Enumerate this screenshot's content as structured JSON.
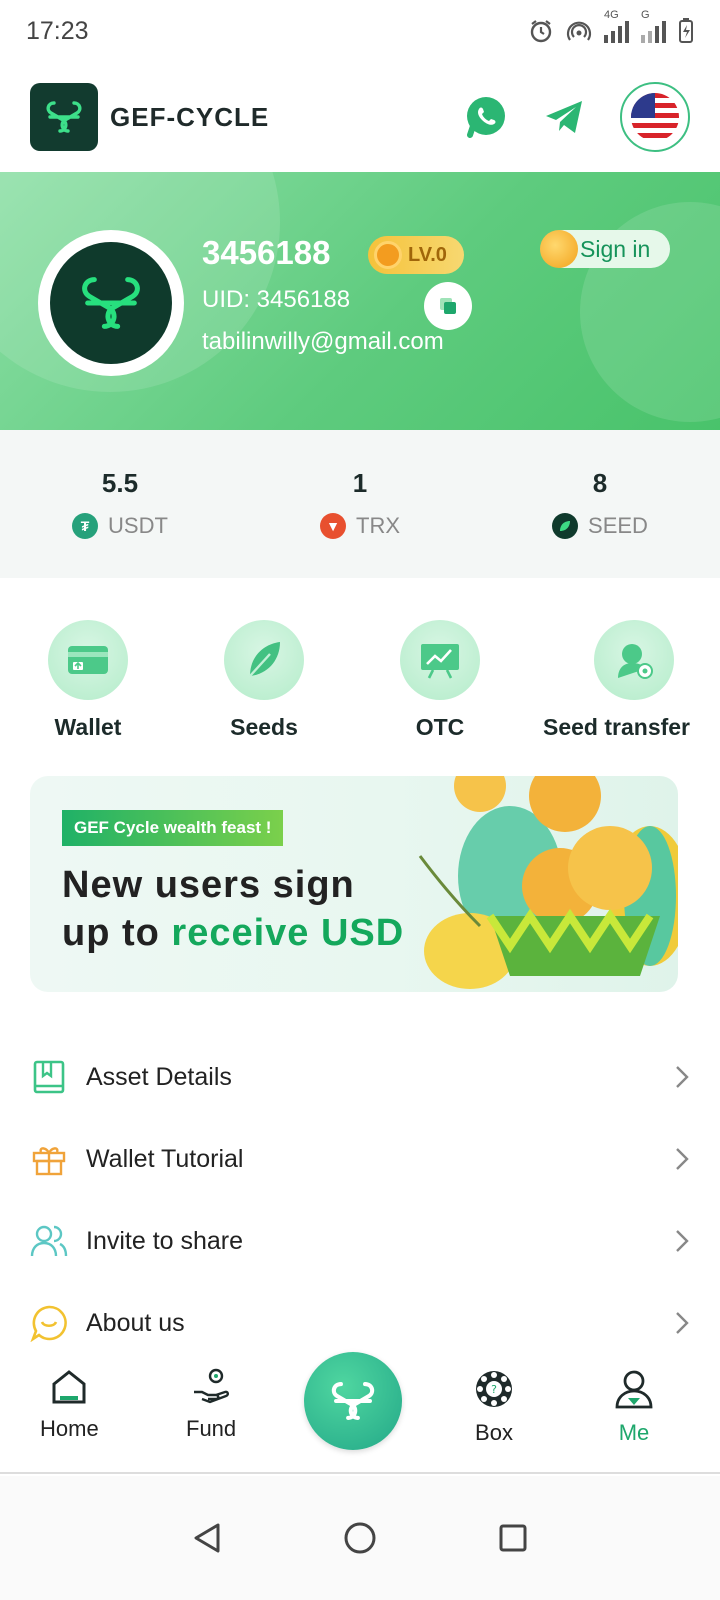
{
  "status_bar": {
    "time": "17:23",
    "network_label_1": "4G",
    "network_label_2": "G"
  },
  "header": {
    "logo_text": "GEF-CYCLE",
    "icons": [
      "whatsapp-icon",
      "telegram-icon",
      "us-flag-icon"
    ]
  },
  "profile": {
    "name": "3456188",
    "level": "LV.0",
    "uid": "UID: 3456188",
    "email": "tabilinwilly@gmail.com",
    "signin_label": "Sign in"
  },
  "balances": [
    {
      "value": "5.5",
      "currency": "USDT",
      "color": "#26a17b"
    },
    {
      "value": "1",
      "currency": "TRX",
      "color": "#e8502f"
    },
    {
      "value": "8",
      "currency": "SEED",
      "color": "#0f3a2c"
    }
  ],
  "quick_actions": [
    {
      "label": "Wallet",
      "icon": "wallet-icon"
    },
    {
      "label": "Seeds",
      "icon": "leaf-icon"
    },
    {
      "label": "OTC",
      "icon": "chart-board-icon"
    },
    {
      "label": "Seed transfer",
      "icon": "transfer-user-icon"
    }
  ],
  "promo": {
    "tag": "GEF Cycle wealth feast !",
    "line1": "New users sign",
    "line2_prefix": "up to ",
    "line2_highlight": "receive USD"
  },
  "menu": [
    {
      "label": "Asset Details",
      "icon": "book-icon"
    },
    {
      "label": "Wallet Tutorial",
      "icon": "gift-icon"
    },
    {
      "label": "Invite to share",
      "icon": "users-icon"
    },
    {
      "label": "About us",
      "icon": "smile-icon"
    }
  ],
  "bottom_nav": [
    {
      "label": "Home",
      "icon": "home-icon",
      "active": false
    },
    {
      "label": "Fund",
      "icon": "fund-hand-icon",
      "active": false
    },
    {
      "label": "Box",
      "icon": "box-wheel-icon",
      "active": false
    },
    {
      "label": "Me",
      "icon": "person-icon",
      "active": true
    }
  ],
  "colors": {
    "brand_green": "#1ea76c",
    "banner_green": "#5ecb7e",
    "logo_dark": "#123b2f"
  }
}
